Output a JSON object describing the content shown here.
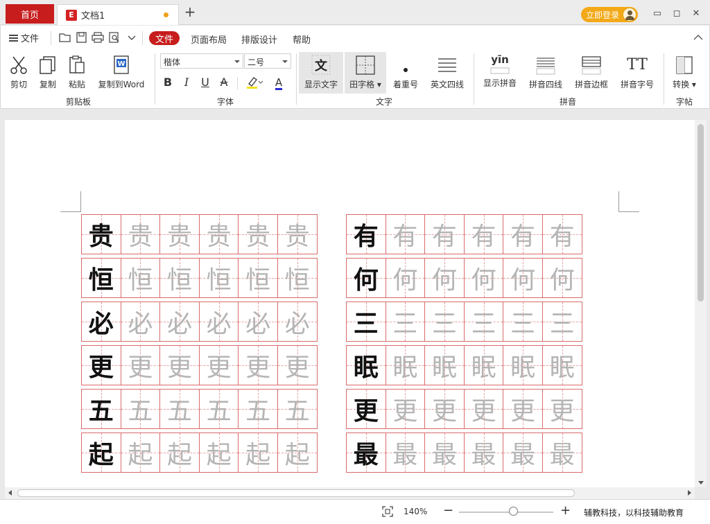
{
  "tabs": {
    "home": "首页",
    "doc": "文档1",
    "doc_logo": "E",
    "add": "+"
  },
  "account": {
    "login": "立即登录"
  },
  "window": {
    "min": "▭",
    "max": "◻",
    "close": "✕"
  },
  "menu": {
    "file": "文件",
    "active": "文件",
    "items": [
      "页面布局",
      "排版设计",
      "帮助"
    ]
  },
  "ribbon": {
    "clipboard": {
      "cut": "剪切",
      "copy": "复制",
      "paste": "粘贴",
      "copy_to_word": "复制到Word",
      "group": "剪贴板"
    },
    "font": {
      "family": "楷体",
      "size": "二号",
      "bold": "B",
      "italic": "I",
      "underline": "U",
      "strike": "A",
      "highlight": "A",
      "color": "A",
      "group": "字体"
    },
    "text": {
      "show_text": "显示文字",
      "tianzige": "田字格",
      "emphasis": "着重号",
      "english_four_lines": "英文四线",
      "group": "文字",
      "show_text_icon": "文"
    },
    "pinyin": {
      "show_pinyin": "显示拼音",
      "pinyin_icon": "yīn",
      "four_lines": "拼音四线",
      "border": "拼音边框",
      "font_size": "拼音字号",
      "group": "拼音",
      "size_icon": "TT"
    },
    "post": {
      "convert": "转换",
      "group": "字帖"
    }
  },
  "document": {
    "left_block": [
      [
        "贵",
        "贵",
        "贵",
        "贵",
        "贵",
        "贵"
      ],
      [
        "恒",
        "恒",
        "恒",
        "恒",
        "恒",
        "恒"
      ],
      [
        "必",
        "必",
        "必",
        "必",
        "必",
        "必"
      ],
      [
        "更",
        "更",
        "更",
        "更",
        "更",
        "更"
      ],
      [
        "五",
        "五",
        "五",
        "五",
        "五",
        "五"
      ],
      [
        "起",
        "起",
        "起",
        "起",
        "起",
        "起"
      ]
    ],
    "right_block": [
      [
        "有",
        "有",
        "有",
        "有",
        "有",
        "有"
      ],
      [
        "何",
        "何",
        "何",
        "何",
        "何",
        "何"
      ],
      [
        "三",
        "三",
        "三",
        "三",
        "三",
        "三"
      ],
      [
        "眠",
        "眠",
        "眠",
        "眠",
        "眠",
        "眠"
      ],
      [
        "更",
        "更",
        "更",
        "更",
        "更",
        "更"
      ],
      [
        "最",
        "最",
        "最",
        "最",
        "最",
        "最"
      ]
    ]
  },
  "status": {
    "zoom": "140%",
    "minus": "−",
    "plus": "+",
    "slogan": "辅教科技，以科技辅助教育"
  }
}
